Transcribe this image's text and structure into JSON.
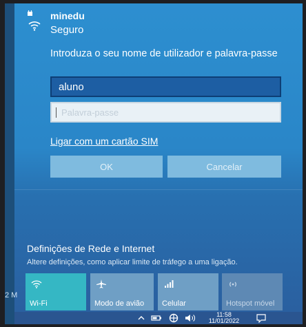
{
  "side": {
    "label": "2 M"
  },
  "network": {
    "name": "minedu",
    "status": "Seguro",
    "icon": "wifi-secured-icon"
  },
  "login": {
    "prompt": "Introduza o seu nome de utilizador e palavra-passe",
    "username_value": "aluno",
    "password_placeholder": "Palavra-passe",
    "sim_link": "Ligar com um cartão SIM",
    "ok_label": "OK",
    "cancel_label": "Cancelar"
  },
  "settings": {
    "title": "Definições de Rede e Internet",
    "description": "Altere definições, como aplicar limite de tráfego a uma ligação."
  },
  "tiles": [
    {
      "label": "Wi-Fi",
      "icon": "wifi-icon",
      "active": true
    },
    {
      "label": "Modo de avião",
      "icon": "airplane-icon",
      "active": false
    },
    {
      "label": "Celular",
      "icon": "cellular-icon",
      "active": false
    },
    {
      "label": "Hotspot móvel",
      "icon": "hotspot-icon",
      "active": false
    }
  ],
  "taskbar": {
    "time": "11:58",
    "date": "11/01/2022",
    "icons": [
      "chevron-up-icon",
      "battery-icon",
      "network-icon",
      "volume-icon",
      "notification-icon"
    ]
  },
  "colors": {
    "panel": "#2a86c8",
    "input_active": "#1d5ea3",
    "button_disabled": "#7fbbdf",
    "tile_active": "#35b7c4",
    "tile_inactive": "#6f9fc5"
  }
}
